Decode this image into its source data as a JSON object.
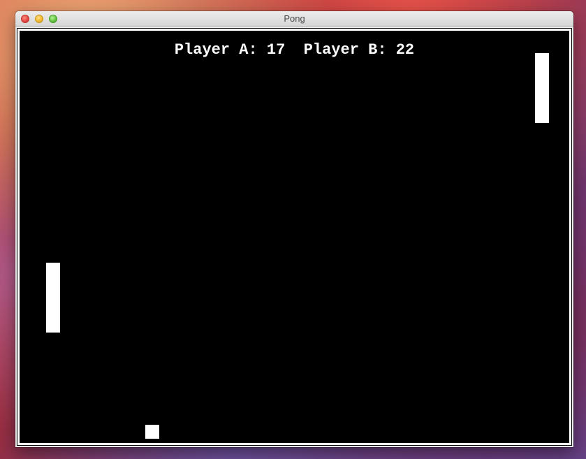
{
  "window": {
    "title": "Pong"
  },
  "scoreboard": {
    "player_a_label": "Player A:",
    "player_a_score": "17",
    "player_b_label": "Player B:",
    "player_b_score": "22"
  },
  "colors": {
    "court_background": "#000000",
    "foreground": "#ffffff"
  }
}
